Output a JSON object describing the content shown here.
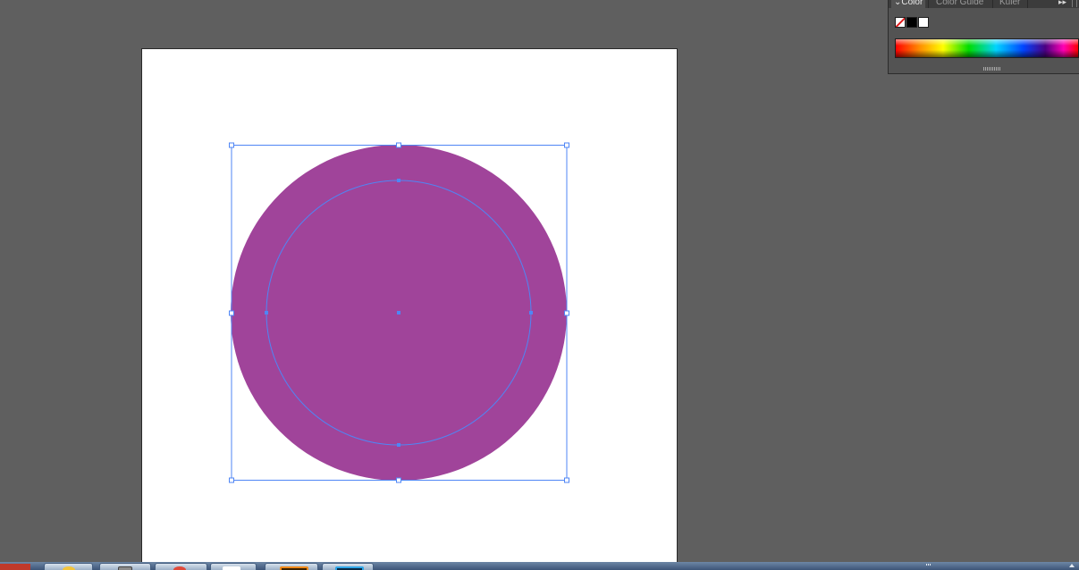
{
  "canvas": {
    "background_color": "#5f5f5f",
    "artboard_color": "#ffffff",
    "shape": {
      "type": "compound-circle",
      "fill_color": "#a0449a",
      "outer_ring": "solid-fill",
      "inner_circle_path": "selected",
      "selection_color": "#4f86f5"
    }
  },
  "color_panel": {
    "tabs": [
      {
        "label": "Color",
        "active": true
      },
      {
        "label": "Color Guide",
        "active": false
      },
      {
        "label": "Kuler",
        "active": false
      }
    ],
    "menu_icon": "panel-menu-icon",
    "swatches": [
      {
        "name": "none",
        "color": "none"
      },
      {
        "name": "black",
        "color": "#000000"
      },
      {
        "name": "white",
        "color": "#ffffff"
      }
    ],
    "spectrum": "color-spectrum-bar"
  },
  "taskbar": {
    "buttons": [
      {
        "icon": "chrome-icon"
      },
      {
        "icon": "explorer-icon"
      },
      {
        "icon": "media-icon"
      },
      {
        "icon": "document-icon"
      },
      {
        "icon": "illustrator-icon"
      },
      {
        "icon": "photoshop-icon"
      }
    ]
  }
}
